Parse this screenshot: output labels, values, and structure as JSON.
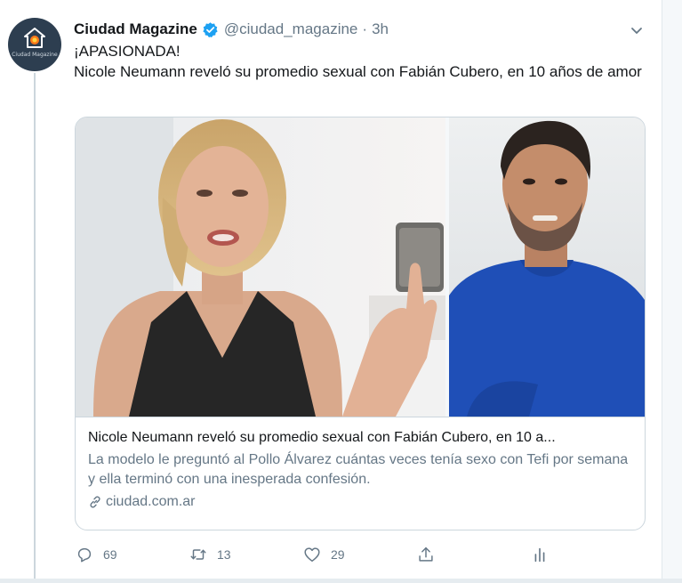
{
  "tweet": {
    "author_name": "Ciudad Magazine",
    "handle": "@ciudad_magazine",
    "separator": "·",
    "time": "3h",
    "avatar_text": "Ciudad Magazine",
    "text_line1": "¡APASIONADA!",
    "text_line2": "Nicole Neumann reveló su promedio sexual con Fabián Cubero, en 10 años de amor"
  },
  "card": {
    "title": "Nicole Neumann reveló su promedio sexual con Fabián Cubero, en 10 a...",
    "description": "La modelo le preguntó al Pollo Álvarez cuántas veces tenía sexo con Tefi por semana y ella terminó con una inesperada confesión.",
    "domain": "ciudad.com.ar"
  },
  "actions": {
    "reply_count": "69",
    "retweet_count": "13",
    "like_count": "29"
  },
  "colors": {
    "verified": "#1da1f2",
    "secondary_text": "#657786",
    "border": "#ccd6dd"
  },
  "icons": [
    "verified-badge-icon",
    "chevron-down-icon",
    "link-icon",
    "reply-icon",
    "retweet-icon",
    "like-icon",
    "share-icon",
    "analytics-icon"
  ]
}
